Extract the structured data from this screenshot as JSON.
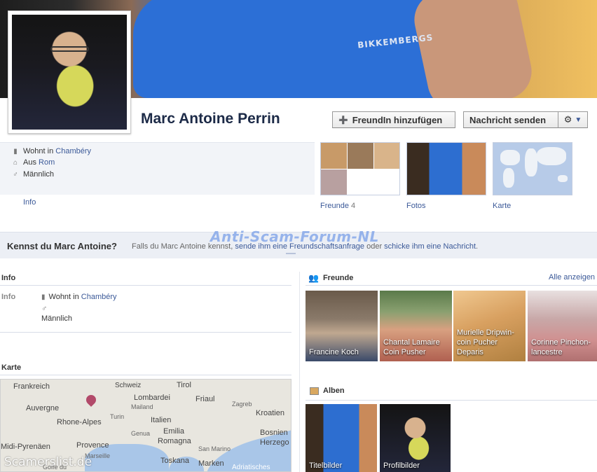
{
  "profile": {
    "name": "Marc Antoine Perrin",
    "cover_text": "BIKKEMBERGS"
  },
  "actions": {
    "add_friend_label": "FreundIn hinzufügen",
    "send_message_label": "Nachricht senden"
  },
  "intro": {
    "lives_prefix": "Wohnt in ",
    "lives_city": "Chambéry",
    "from_prefix": "Aus ",
    "from_city": "Rom",
    "gender": "Männlich",
    "info_link": "Info"
  },
  "tiles": {
    "friends_label": "Freunde",
    "friends_count": "4",
    "photos_label": "Fotos",
    "map_label": "Karte"
  },
  "prompt": {
    "title": "Kennst du Marc Antoine?",
    "text_1": "Falls du Marc Antoine kennst, ",
    "link_1": "sende ihm eine Freundschaftsanfrage",
    "text_2": " oder ",
    "link_2": "schicke ihm eine Nachricht",
    "text_3": "."
  },
  "watermarks": {
    "top": "Anti-Scam-Forum-NL",
    "bottom": "Scamerslist.de"
  },
  "info_section": {
    "title": "Info",
    "row_label": "Info",
    "lives_prefix": "Wohnt in ",
    "lives_city": "Chambéry",
    "gender": "Männlich"
  },
  "map_section": {
    "title": "Karte",
    "labels": [
      "Frankreich",
      "Schweiz",
      "Tirol",
      "Auvergne",
      "Lombardei",
      "Friaul",
      "Rhone-Alpes",
      "Italien",
      "Kroatien",
      "Emilia",
      "Romagna",
      "Provence",
      "Midi-Pyrenäen",
      "Bosnien",
      "Herzego",
      "Toskana",
      "Marken",
      "Adriatisches"
    ],
    "small_labels": [
      "Mailand",
      "Turin",
      "Genua",
      "Zagreb",
      "San Marino",
      "Marseille",
      "Golfe du"
    ]
  },
  "friends_section": {
    "title": "Freunde",
    "see_all": "Alle anzeigen",
    "friends": [
      {
        "name": "Francine Koch"
      },
      {
        "name": "Chantal Lamaire Coin Pusher"
      },
      {
        "name": "Murielle Dripwin-coin Pucher Deparis"
      },
      {
        "name": "Corinne Pinchon-lancestre"
      }
    ]
  },
  "albums_section": {
    "title": "Alben",
    "albums": [
      {
        "name": "Titelbilder"
      },
      {
        "name": "Profilbilder"
      }
    ]
  },
  "colors": {
    "link": "#3b5998",
    "name": "#1c2a47",
    "strip": "#eceff5"
  }
}
